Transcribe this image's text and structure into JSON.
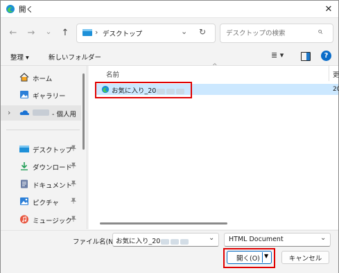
{
  "window": {
    "title": "開く",
    "close": "✕"
  },
  "nav": {
    "back": "←",
    "forward": "→",
    "recent": "⌄",
    "up": "↑",
    "address": {
      "separator": "›",
      "location": "デスクトップ",
      "dropdown": "⌄",
      "refresh": "↻"
    },
    "search": {
      "placeholder": "デスクトップの検索",
      "icon": "⌕"
    }
  },
  "command_bar": {
    "organize": "整理 ▾",
    "new_folder": "新しいフォルダー",
    "view_menu": "≣ ▾",
    "help": "?"
  },
  "sidebar": {
    "items": [
      {
        "label": "ホーム"
      },
      {
        "label": "ギャラリー"
      },
      {
        "label": "- 個人用",
        "expander": "›"
      },
      {
        "label": "デスクトップ",
        "pin": "📌"
      },
      {
        "label": "ダウンロード",
        "pin": "📌"
      },
      {
        "label": "ドキュメント",
        "pin": "📌"
      },
      {
        "label": "ピクチャ",
        "pin": "📌"
      },
      {
        "label": "ミュージック",
        "pin": "📌"
      }
    ]
  },
  "file_list": {
    "sort_arrow": "^",
    "columns": [
      {
        "label": "名前"
      },
      {
        "label": "更"
      }
    ],
    "rows": [
      {
        "name": "お気に入り_20",
        "date_partial": "20"
      }
    ]
  },
  "bottom": {
    "filename_label": "ファイル名(N):",
    "filename_value": "お気に入り_20",
    "filetype": "HTML Document",
    "open_button": "開く(O)",
    "cancel_button": "キャンセル"
  },
  "colors": {
    "accent": "#0067c0",
    "highlight": "#e00000",
    "selection": "#cce8ff"
  }
}
